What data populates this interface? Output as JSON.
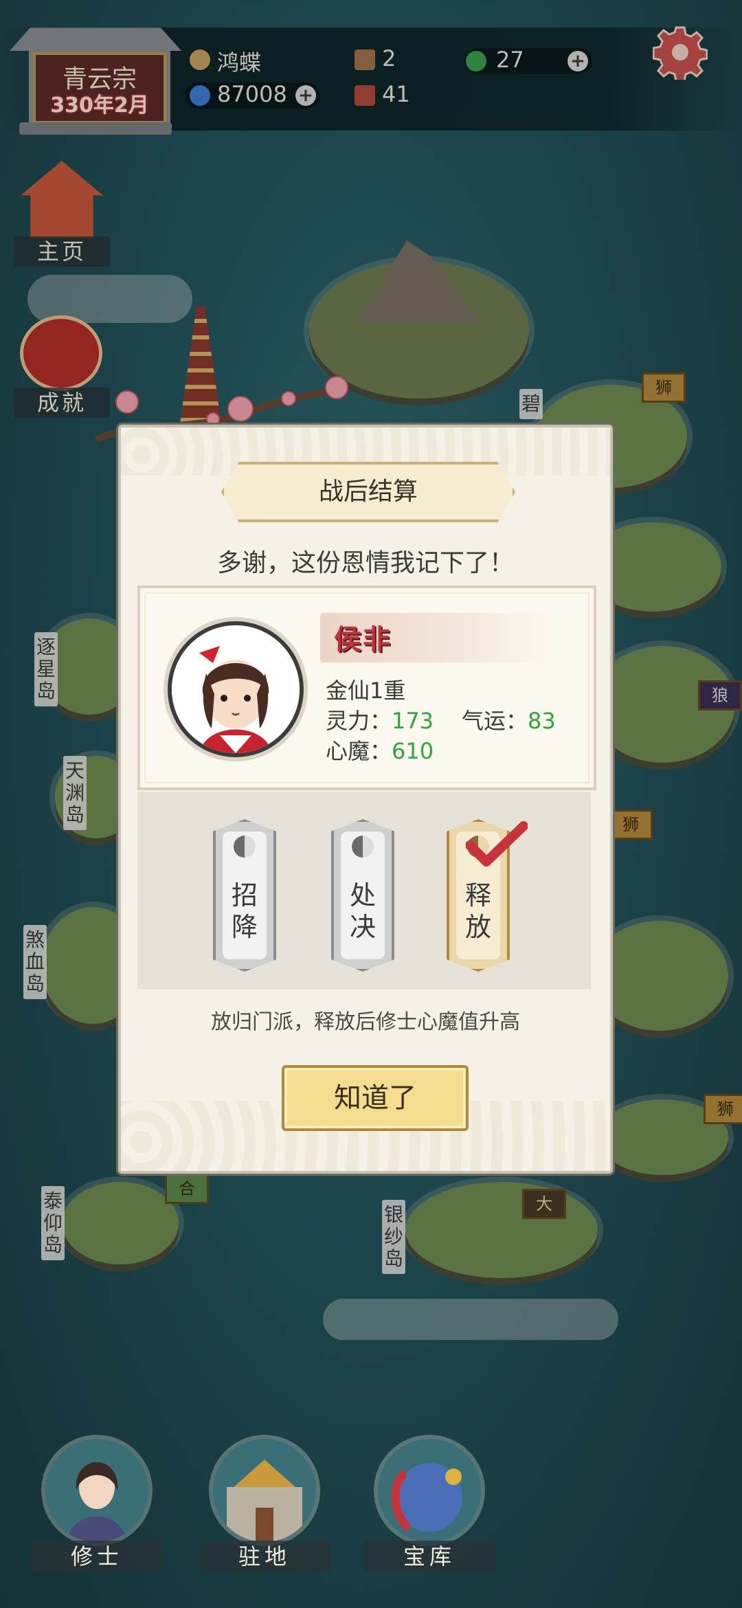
{
  "hud": {
    "sect_name": "青云宗",
    "sect_date": "330年2月",
    "player_name": "鸿蝶",
    "spirit_stones": "87008",
    "houses": "2",
    "disciples": "41",
    "jade": "27",
    "plus": "+"
  },
  "side": {
    "home_label": "主页",
    "achievements_label": "成就"
  },
  "islands": {
    "zhuxing": "逐星岛",
    "tianyuan": "天渊岛",
    "shaxue": "煞血岛",
    "taiyang": "泰仰岛",
    "yinsha": "银纱岛",
    "bi": "碧"
  },
  "flags": {
    "shi1": "狮",
    "shi2": "狮",
    "shi3": "狮",
    "lang": "狼",
    "he": "合",
    "da": "大"
  },
  "dialog": {
    "title": "战后结算",
    "message": "多谢，这份恩情我记下了！",
    "character": {
      "name": "侯非",
      "realm": "金仙1重",
      "spirit_label": "灵力：",
      "spirit_value": "173",
      "luck_label": "气运：",
      "luck_value": "83",
      "demon_label": "心魔：",
      "demon_value": "610"
    },
    "choices": [
      {
        "line1": "招",
        "line2": "降",
        "selected": false
      },
      {
        "line1": "处",
        "line2": "决",
        "selected": false
      },
      {
        "line1": "释",
        "line2": "放",
        "selected": true
      }
    ],
    "hint": "放归门派，释放后修士心魔值升高",
    "ok_label": "知道了"
  },
  "nav": {
    "cultivators": "修士",
    "base": "驻地",
    "treasury": "宝库"
  },
  "colors": {
    "sea": "#24545c",
    "accent_green": "#2fa53a",
    "name_red": "#c0333a",
    "ok_gold": "#f4dd8e"
  }
}
